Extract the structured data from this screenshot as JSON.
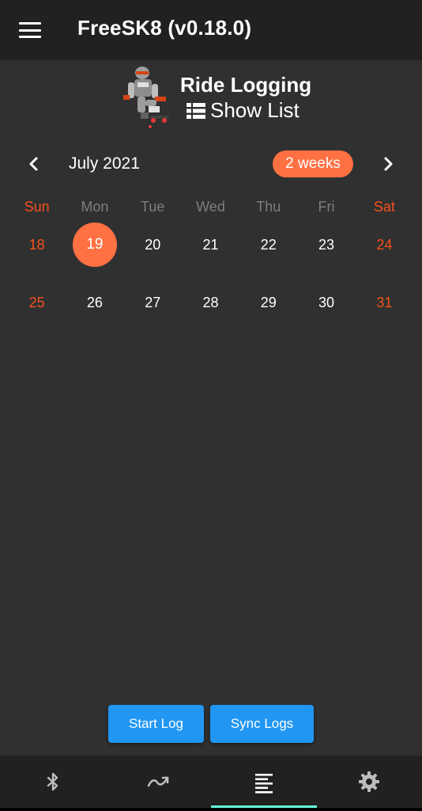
{
  "app_bar": {
    "title": "FreeSK8 (v0.18.0)",
    "menu_icon": "hamburger-menu-icon"
  },
  "header": {
    "title": "Ride Logging",
    "show_list_label": "Show List",
    "list_icon": "list-icon",
    "avatar": "robot-skater-image"
  },
  "calendar": {
    "month_label": "July 2021",
    "format_button_label": "2 weeks",
    "weekdays": [
      "Sun",
      "Mon",
      "Tue",
      "Wed",
      "Thu",
      "Fri",
      "Sat"
    ],
    "weeks": [
      [
        "18",
        "19",
        "20",
        "21",
        "22",
        "23",
        "24"
      ],
      [
        "25",
        "26",
        "27",
        "28",
        "29",
        "30",
        "31"
      ]
    ],
    "selected_day": "19"
  },
  "actions": {
    "start_log_label": "Start Log",
    "sync_logs_label": "Sync Logs"
  },
  "bottom_nav": {
    "items": [
      {
        "icon": "bluetooth-icon"
      },
      {
        "icon": "trending-icon"
      },
      {
        "icon": "text-lines-icon",
        "active": true
      },
      {
        "icon": "settings-gear-icon"
      }
    ]
  },
  "colors": {
    "background": "#303030",
    "app_bar": "#212121",
    "accent": "#ff7043",
    "weekend": "#f4511e",
    "button": "#2196f3",
    "nav_indicator": "#64ffda"
  }
}
